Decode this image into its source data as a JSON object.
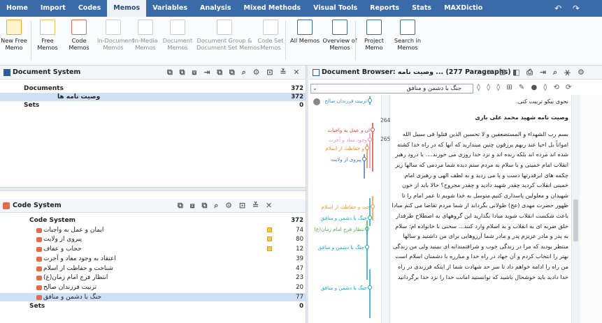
{
  "menubar": {
    "items": [
      "Home",
      "Import",
      "Codes",
      "Memos",
      "Variables",
      "Analysis",
      "Mixed Methods",
      "Visual Tools",
      "Reports",
      "Stats",
      "MAXDictio"
    ],
    "active_index": 3,
    "undo_redo": "↶ ↷"
  },
  "ribbon": {
    "buttons": [
      {
        "label": "New Free\nMemo",
        "icon": "new-free-memo-icon",
        "enabled": true
      },
      {
        "label": "Free\nMemos",
        "icon": "free-memos-icon",
        "enabled": true
      },
      {
        "label": "Code\nMemos",
        "icon": "code-memos-icon",
        "enabled": true
      },
      {
        "label": "In-Document\nMemos",
        "icon": "in-document-memos-icon",
        "enabled": false
      },
      {
        "label": "In-Media\nMemos",
        "icon": "in-media-memos-icon",
        "enabled": false
      },
      {
        "label": "Document\nMemos",
        "icon": "document-memos-icon",
        "enabled": false
      },
      {
        "label": "Document Group &\nDocument Set Memos",
        "icon": "document-group-memos-icon",
        "enabled": false
      },
      {
        "label": "Code Set\nMemos",
        "icon": "code-set-memos-icon",
        "enabled": false
      },
      {
        "label": "All Memos",
        "icon": "all-memos-icon",
        "enabled": true
      },
      {
        "label": "Overview of\nMemos",
        "icon": "overview-memos-icon",
        "enabled": true
      },
      {
        "label": "Project\nMemo",
        "icon": "project-memo-icon",
        "enabled": true
      },
      {
        "label": "Search in\nMemos",
        "icon": "search-memos-icon",
        "enabled": true
      }
    ]
  },
  "document_system": {
    "title": "Document System",
    "tools": "⧉ ⧉ ⧈  ⇥ ⧉ ⧉  ⌕  ⚙  ⊡ ≚ ✕",
    "rows": [
      {
        "label": "Documents",
        "count": "372",
        "bold": true
      },
      {
        "label": "وصیت نامه ها",
        "count": "372",
        "bold": true
      },
      {
        "label": "Sets",
        "count": "0",
        "bold": true
      }
    ]
  },
  "code_system": {
    "title": "Code System",
    "tools": "⧉  ⧈  ⧉  ⌕  ⚙  ⊡ ≚ ✕",
    "rows": [
      {
        "label": "Code System",
        "count": "372",
        "bold": true
      },
      {
        "label": "ایمان و عمل به واجبات",
        "count": "74"
      },
      {
        "label": "پیروی از ولایت",
        "count": "80"
      },
      {
        "label": "حجاب و عفاف",
        "count": "12"
      },
      {
        "label": "اعتقاد به وجود معاد و آخرت",
        "count": "39"
      },
      {
        "label": "شناخت و حفاظت از اسلام",
        "count": "47"
      },
      {
        "label": "انتظار فرج امام زمان(ع)",
        "count": "23"
      },
      {
        "label": "تربیت فرزندان صالح",
        "count": "20"
      },
      {
        "label": "جنگ با دشمن و منافق",
        "count": "77"
      },
      {
        "label": "Sets",
        "count": "0",
        "bold": true
      }
    ]
  },
  "document_browser": {
    "title": "Document Browser: وصیت نامه ...  (277 Paragraphs)",
    "tools": "⌕ ⌕ ⊟  ◧  ⎙ ⇥  ⌕  ⚹  ⚙",
    "code_select": "جنگ با دشمن و منافق",
    "toolbar2": "◊ ◊ ◊ ⊞ ✎ ● ◊ ⟲ ⟳",
    "paragraph_numbers": [
      "264",
      "265"
    ],
    "code_stripes": [
      {
        "label": "تربیت فرزندان صالح",
        "color": "#3e8fd1"
      },
      {
        "label": "ان و عمل به واجبات",
        "color": "#d94a3b"
      },
      {
        "label": "وجود معاد و آخرت",
        "color": "#e88fb6"
      },
      {
        "label": "و حفاظت از اسلام",
        "color": "#e88a3a"
      },
      {
        "label": "پیروی از ولایت",
        "color": "#4a6fc9"
      },
      {
        "label": "خت و حفاظت از اسلام",
        "color": "#e8963c"
      },
      {
        "label": "جنگ با دشمن و منافق",
        "color": "#1ba3c6"
      },
      {
        "label": "نتظار فرج امام زمان(ع)",
        "color": "#4fae4a"
      },
      {
        "label": "جنگ با دشمن و منافق",
        "color": "#1ba3c6"
      },
      {
        "label": "جنگ با دشمن و منافق",
        "color": "#1ba3c6"
      }
    ],
    "paragraphs": [
      "نحوی نیکو تربیت کنی.",
      "وصیت نامه شهید محمد علی باری",
      "بسم رب الشهداء و المستضعفین و لا تحسبن الذین قتلوا فی سبیل الله امواتاً بل احیا عند ربهم یرزقون چنین میندارید که آنها که در راه خدا کشته شده اند مرده اند بلکه زنده اند و نزد خدا روزی می خورند.... با درود رهبر انقلاب امام خمینی و با سلام به مردم ستم دیده شما مردمی که سالها زیر چکمه های ابرقدرتها دست و پا می زدید و به لطف الهی و رهبری امام خمینی انقلاب کردید چقدر شهید دادید و چقدر مجروح؟ حالا باید از خون شهیدان و معلولین پاسداری کنیم.متوسل به خدا شویم تا عمر امام را تا ظهور حضرت مهدی (عج) طولانی بگرداند از شما مردم تقاضا می کنم مبادا باعث شکست انقلاب شوید مبادا بگذارید این گروههای به اصطلاح طرفدار خلق ضربه ای به انقلاب و به اسلام وارد کنند... سخنی با خانواده ام: سلام به پدر و مادر عزیزم پدر و مادر شما آرزوهایی برای من داشتید و سالها منتظر بودید که مرا در زندگی خوب و شرافتمندانه ای ببینید ولی من زندگی بهتر را انتخاب کردم و آن جهاد در راه خدا و مبارزه با دشمنان اسلام است من راه را ادامه خواهم داد تا سر حد شهادت شما از اینکه فرزندی در راه خدا دادید باید خوشحال باشید که توانستید امانت خدا را نزد خدا برگردانید"
    ],
    "colors": {
      "accent": "#3b6aa8",
      "stripe_blue": "#1ba3c6"
    }
  }
}
